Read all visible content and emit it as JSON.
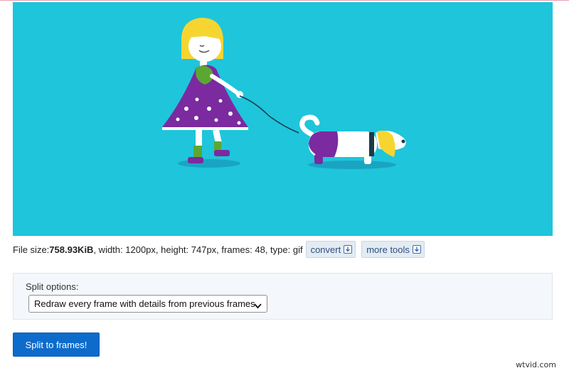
{
  "file_info": {
    "size_label": "File size: ",
    "size_value": "758.93KiB",
    "details": ", width: 1200px, height: 747px, frames: 48, type: gif"
  },
  "tools": {
    "convert_label": "convert",
    "more_tools_label": "more tools"
  },
  "split_options": {
    "label": "Split options:",
    "selected": "Redraw every frame with details from previous frames"
  },
  "submit": {
    "label": "Split to frames!"
  },
  "watermark": "wtvid.com",
  "colors": {
    "preview_background": "#1fc5db",
    "primary_button": "#0d6bcc",
    "accent_purple": "#7b2aa0",
    "accent_yellow": "#f7d531",
    "accent_green": "#5aa832"
  },
  "preview": {
    "content": "animated-gif-girl-walking-dog"
  }
}
